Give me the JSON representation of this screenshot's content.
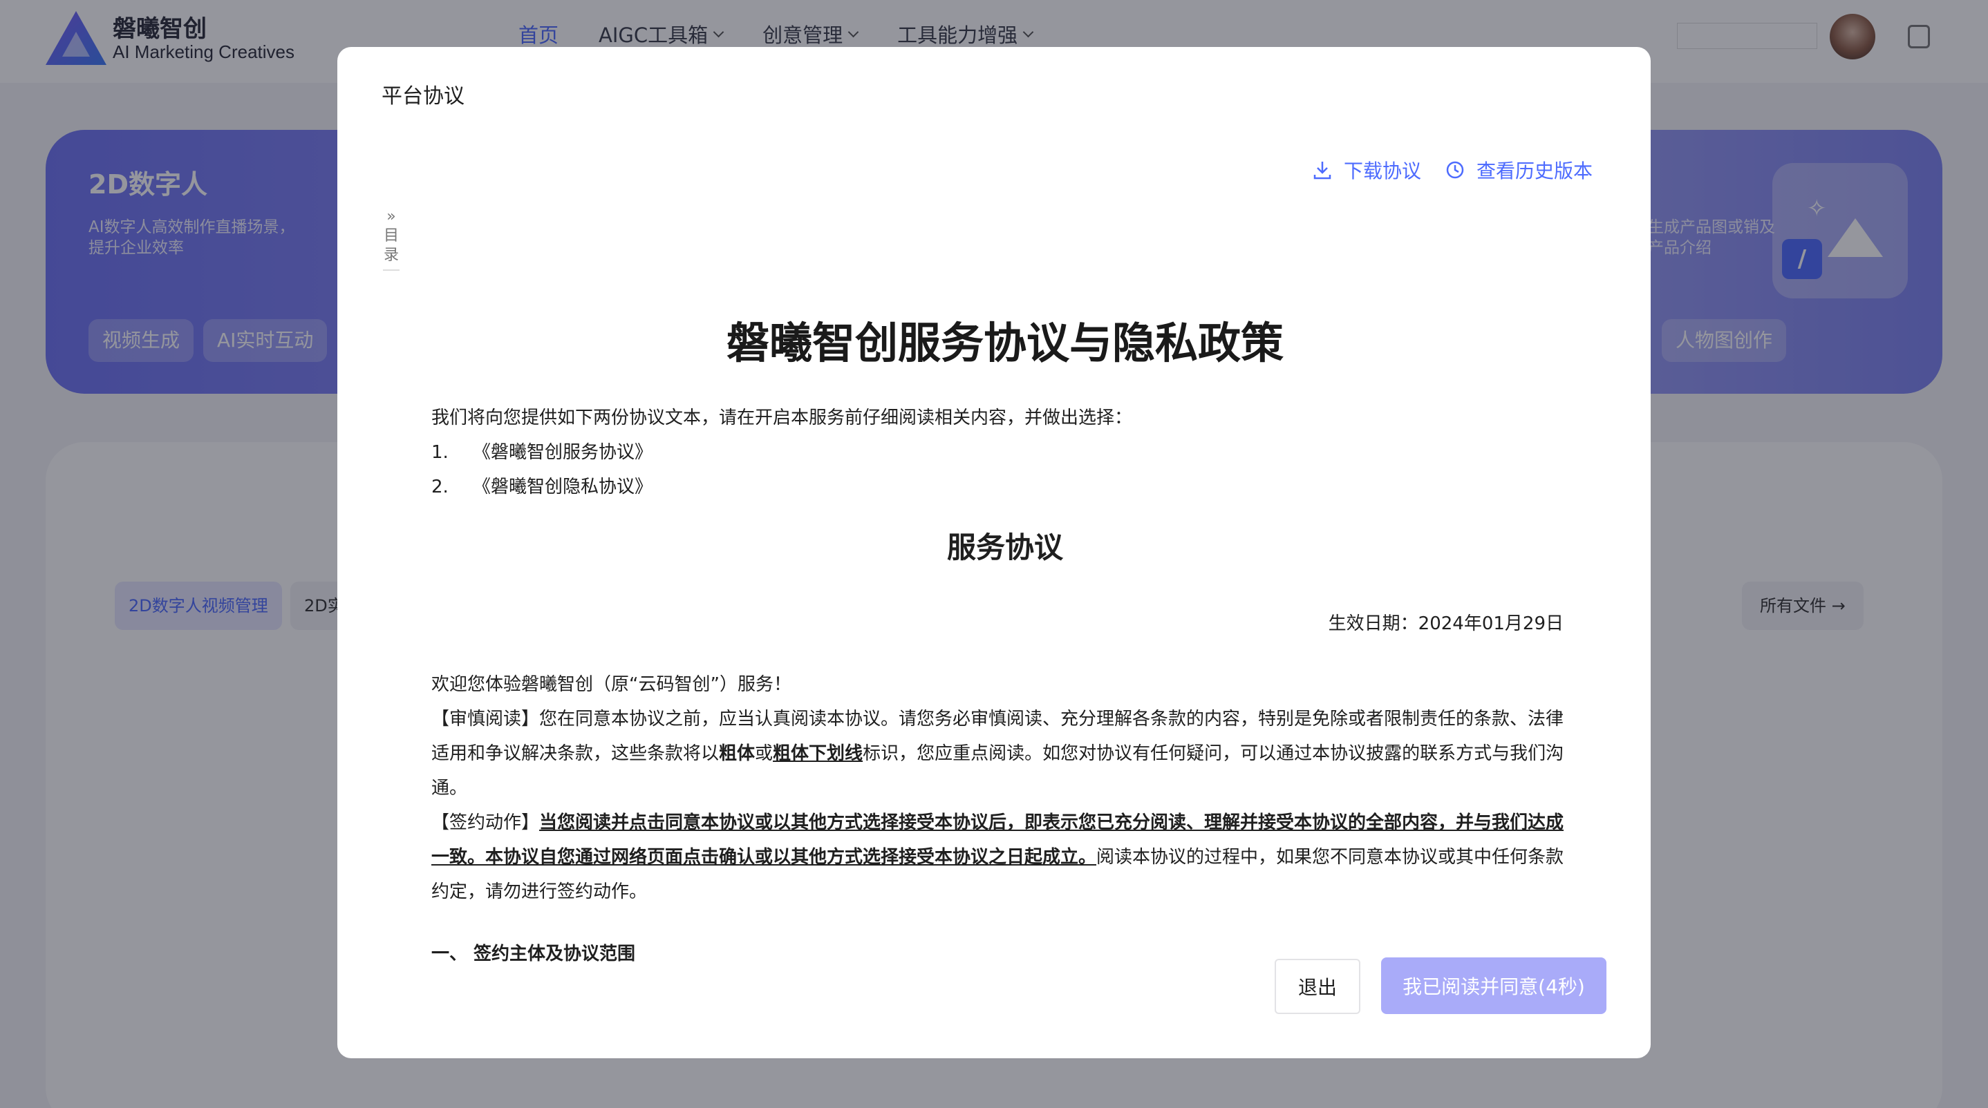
{
  "header": {
    "brand_name": "磐曦智创",
    "brand_sub": "AI Marketing Creatives",
    "nav": [
      {
        "label": "首页"
      },
      {
        "label": "AIGC工具箱"
      },
      {
        "label": "创意管理"
      },
      {
        "label": "工具能力增强"
      }
    ]
  },
  "banner": {
    "title": "2D数字人",
    "desc": "AI数字人高效制作直播场景，提升企业效率",
    "chip_1": "视频生成",
    "chip_2": "AI实时互动",
    "right_desc": "生成产品图或销及产品介绍",
    "right_chip": "人物图创作"
  },
  "panel": {
    "tab_active": "2D数字人视频管理",
    "tab_other": "2D实",
    "all_files": "所有文件"
  },
  "modal": {
    "title": "平台协议",
    "download_label": "下载协议",
    "history_label": "查看历史版本",
    "toc_label": "目录",
    "doc_title": "磐曦智创服务协议与隐私政策",
    "intro": "我们将向您提供如下两份协议文本，请在开启本服务前仔细阅读相关内容，并做出选择：",
    "list": [
      {
        "num": "1.",
        "text": "《磐曦智创服务协议》"
      },
      {
        "num": "2.",
        "text": "《磐曦智创隐私协议》"
      }
    ],
    "section_title": "服务协议",
    "effective_date": "生效日期：2024年01月29日",
    "welcome": "欢迎您体验磐曦智创（原“云码智创”）服务！",
    "review_p1": "【审慎阅读】您在同意本协议之前，应当认真阅读本协议。请您务必审慎阅读、充分理解各条款的内容，特别是免除或者限制责任的条款、法律适用和争议解决条款，这些条款将以",
    "review_bold": "粗体",
    "review_or": "或",
    "review_bu": "粗体下划线",
    "review_p2": "标识，您应重点阅读。如您对协议有任何疑问，可以通过本协议披露的联系方式与我们沟通。",
    "sign_label": "【签约动作】",
    "sign_bu": "当您阅读并点击同意本协议或以其他方式选择接受本协议后，即表示您已充分阅读、理解并接受本协议的全部内容，并与我们达成一致。本协议自您通过网络页面点击确认或以其他方式选择接受本协议之日起成立。",
    "sign_rest": "阅读本协议的过程中，如果您不同意本协议或其中任何条款约定，请勿进行签约动作。",
    "section_1": "一、 签约主体及协议范围",
    "exit_label": "退出",
    "agree_label": "我已阅读并同意(4秒)"
  },
  "colors": {
    "accent": "#4d6bfe",
    "agree_button": "#a9abf9",
    "overlay": "rgba(20,22,38,0.45)"
  },
  "icons": [
    "logo-icon",
    "download-icon",
    "clock-icon",
    "chevron-down-icon",
    "avatar",
    "note-icon"
  ]
}
